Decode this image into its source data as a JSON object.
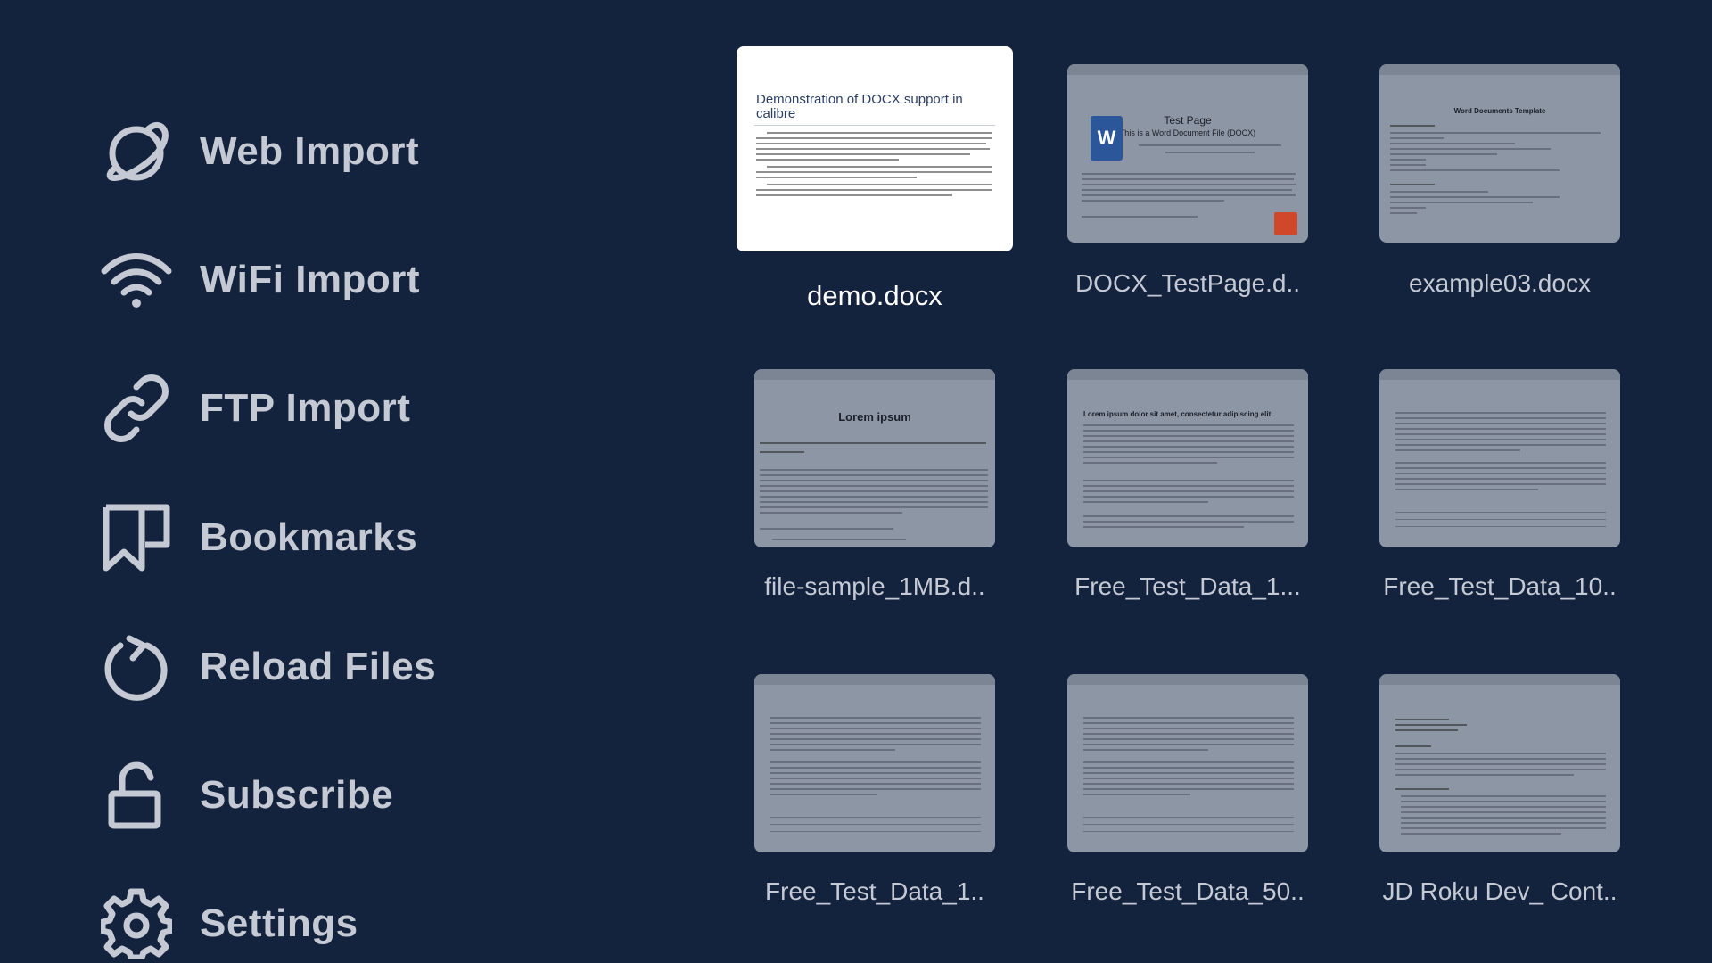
{
  "sidebar": {
    "items": [
      {
        "label": "Web Import",
        "icon": "planet-icon"
      },
      {
        "label": "WiFi Import",
        "icon": "wifi-icon"
      },
      {
        "label": "FTP Import",
        "icon": "link-icon"
      },
      {
        "label": "Bookmarks",
        "icon": "bookmark-icon"
      },
      {
        "label": "Reload Files",
        "icon": "reload-icon"
      },
      {
        "label": "Subscribe",
        "icon": "unlock-icon"
      },
      {
        "label": "Settings",
        "icon": "gear-icon"
      }
    ]
  },
  "files": [
    {
      "name": "demo.docx",
      "heading": "Demonstration of DOCX support in calibre",
      "focused": true
    },
    {
      "name": "DOCX_TestPage.d..",
      "heading": "Test Page",
      "sub": "This is a Word Document File (DOCX)"
    },
    {
      "name": "example03.docx",
      "heading": "Word Documents Template"
    },
    {
      "name": "file-sample_1MB.d..",
      "heading": "Lorem ipsum"
    },
    {
      "name": "Free_Test_Data_1...",
      "heading": "Lorem ipsum dolor sit amet, consectetur adipiscing elit"
    },
    {
      "name": "Free_Test_Data_10.."
    },
    {
      "name": "Free_Test_Data_1.."
    },
    {
      "name": "Free_Test_Data_50.."
    },
    {
      "name": "JD Roku Dev_ Cont.."
    }
  ],
  "colors": {
    "background": "#13223d",
    "text": "#c4c9d3",
    "thumbnail": "#8c96a5",
    "focus": "#ffffff"
  }
}
